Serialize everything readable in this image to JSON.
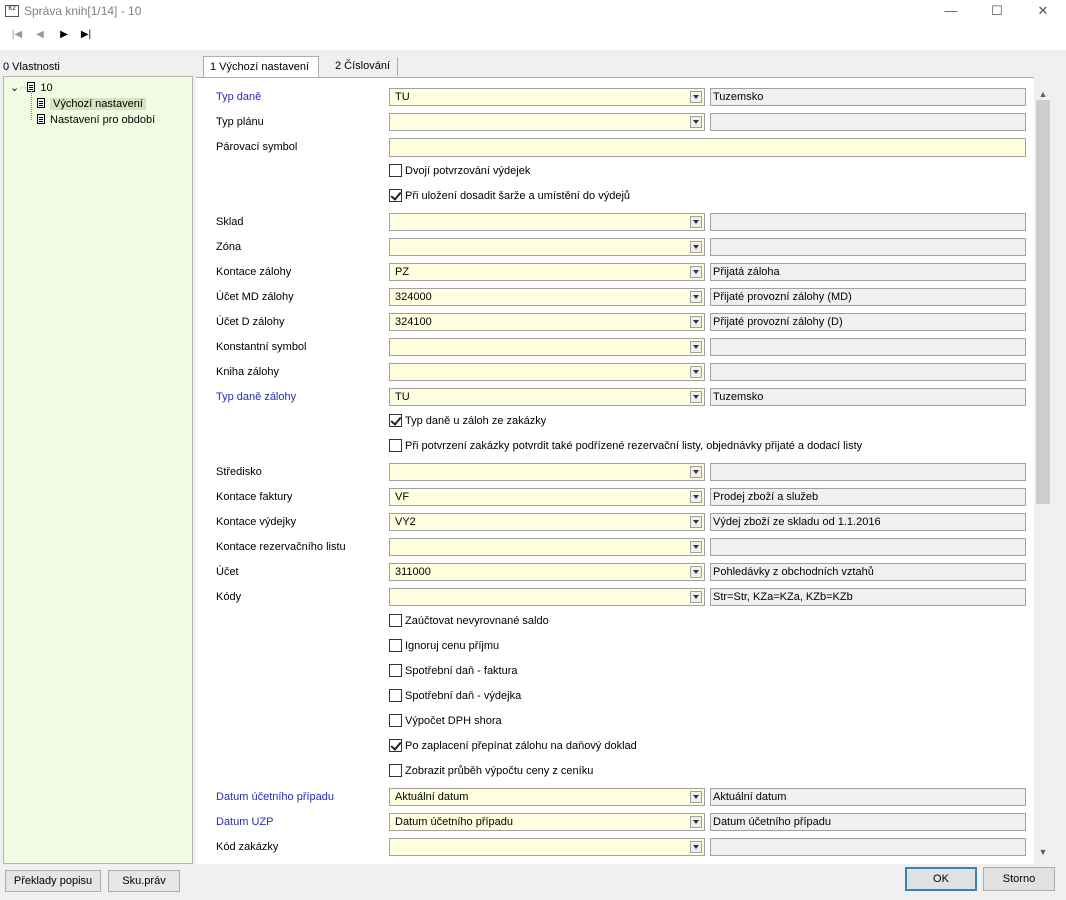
{
  "window": {
    "title": "Správa knih[1/14] - 10",
    "app_icon": "K2",
    "minimize_icon": "—",
    "maximize_icon": "☐",
    "close_icon": "✕"
  },
  "nav": {
    "first": "|◀",
    "prev": "◀",
    "next": "▶",
    "last": "▶|"
  },
  "left_panel": {
    "label": "0 Vlastnosti",
    "tree": {
      "root": "10",
      "items": [
        "Výchozí nastavení",
        "Nastavení pro období"
      ]
    },
    "buttons": {
      "translations": "Překlady popisu",
      "rights": "Sku.práv"
    }
  },
  "tabs": [
    "1 Výchozí nastavení",
    "2 Číslování"
  ],
  "form": {
    "fields": [
      {
        "label": "Typ daně",
        "value": "TU",
        "desc": "Tuzemsko"
      },
      {
        "label": "Typ plánu",
        "value": "",
        "desc": ""
      },
      {
        "label": "Párovací symbol",
        "value": ""
      },
      {
        "check": "Dvojí potvrzování výdejek",
        "checked": false
      },
      {
        "check": "Při uložení dosadit šarže a umístění do výdejů",
        "checked": true
      },
      {
        "label": "Sklad",
        "value": "",
        "desc": ""
      },
      {
        "label": "Zóna",
        "value": "",
        "desc": ""
      },
      {
        "label": "Kontace zálohy",
        "value": "PZ",
        "desc": "Přijatá záloha"
      },
      {
        "label": "Účet MD zálohy",
        "value": "324000",
        "desc": "Přijaté provozní zálohy (MD)"
      },
      {
        "label": "Účet D zálohy",
        "value": "324100",
        "desc": "Přijaté provozní zálohy (D)"
      },
      {
        "label": "Konstantní symbol",
        "value": "",
        "desc": ""
      },
      {
        "label": "Kniha zálohy",
        "value": "",
        "desc": ""
      },
      {
        "label": "Typ daně zálohy",
        "value": "TU",
        "desc": "Tuzemsko"
      },
      {
        "check": "Typ daně u záloh ze zakázky",
        "checked": true
      },
      {
        "check": "Při potvrzení zakázky potvrdit také podřízené rezervační listy, objednávky přijaté a dodací listy",
        "checked": false
      },
      {
        "label": "Středisko",
        "value": "",
        "desc": ""
      },
      {
        "label": "Kontace faktury",
        "value": "VF",
        "desc": "Prodej zboží a služeb"
      },
      {
        "label": "Kontace výdejky",
        "value": "VY2",
        "desc": "Výdej zboží ze skladu od 1.1.2016"
      },
      {
        "label": "Kontace rezervačního listu",
        "value": "",
        "desc": ""
      },
      {
        "label": "Účet",
        "value": "311000",
        "desc": "Pohledávky z obchodních vztahů"
      },
      {
        "label": "Kódy",
        "value": "",
        "desc": "Str=Str, KZa=KZa, KZb=KZb"
      },
      {
        "check": "Zaúčtovat nevyrovnané saldo",
        "checked": false
      },
      {
        "check": "Ignoruj cenu příjmu",
        "checked": false
      },
      {
        "check": "Spotřební daň - faktura",
        "checked": false
      },
      {
        "check": "Spotřební daň - výdejka",
        "checked": false
      },
      {
        "check": "Výpočet DPH shora",
        "checked": false
      },
      {
        "check": "Po zaplacení přepínat zálohu na daňový doklad",
        "checked": true
      },
      {
        "check": "Zobrazit průběh výpočtu ceny z ceníku",
        "checked": false
      },
      {
        "label": "Datum účetního případu",
        "value": "Aktuální datum",
        "desc": "Aktuální datum"
      },
      {
        "label": "Datum UZP",
        "value": "Datum účetního případu",
        "desc": "Datum účetního případu"
      },
      {
        "label": "Kód zakázky",
        "value": "",
        "desc": ""
      }
    ]
  },
  "colors": {
    "required_label": "#2a2ab8",
    "input_bg": "#ffffe0",
    "tree_bg": "#f3fbe3"
  },
  "dialog": {
    "ok": "OK",
    "cancel": "Storno"
  },
  "scroll": {
    "up": "▲",
    "down": "▼"
  }
}
